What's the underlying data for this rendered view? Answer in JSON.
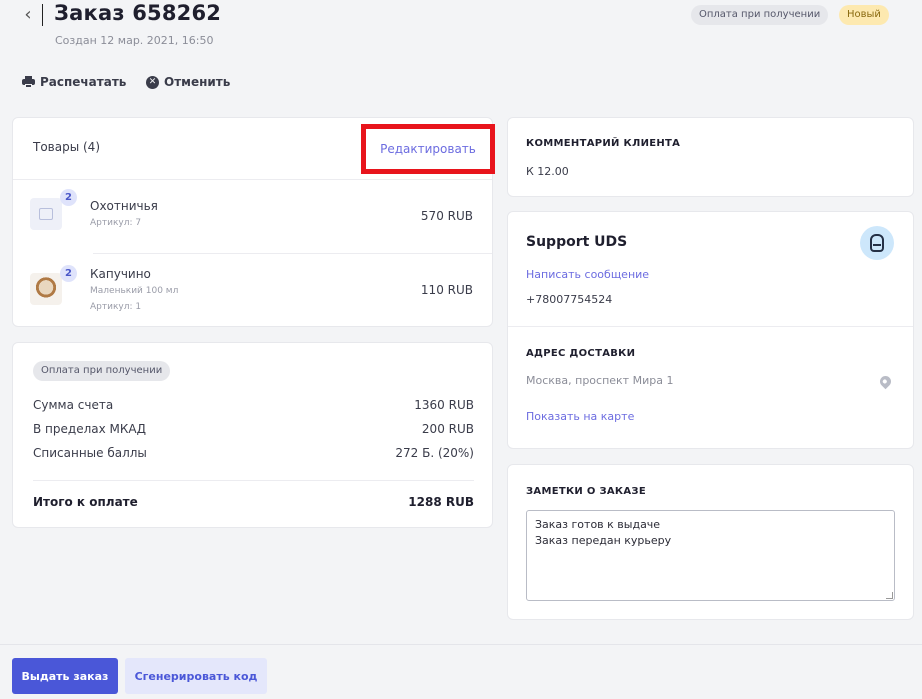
{
  "header": {
    "title": "Заказ 658262",
    "created": "Создан 12 мар. 2021, 16:50",
    "badge_payment": "Оплата при получении",
    "badge_status": "Новый",
    "back_icon": "chevron-left-icon"
  },
  "actions": {
    "print_label": "Распечатать",
    "cancel_label": "Отменить"
  },
  "goods": {
    "title": "Товары (4)",
    "edit_label": "Редактировать",
    "items": [
      {
        "name": "Охотничья",
        "sub1": "Артикул: 7",
        "sub2": "",
        "qty": "2",
        "price": "570 RUB"
      },
      {
        "name": "Капучино",
        "sub1": "Маленький 100 мл",
        "sub2": "Артикул: 1",
        "qty": "2",
        "price": "110 RUB"
      }
    ]
  },
  "payment": {
    "badge": "Оплата при получении",
    "rows": [
      {
        "label": "Сумма счета",
        "value": "1360 RUB"
      },
      {
        "label": "В пределах МКАД",
        "value": "200 RUB"
      },
      {
        "label": "Списанные баллы",
        "value": "272 Б. (20%)"
      }
    ],
    "total_label": "Итого к оплате",
    "total_value": "1288 RUB"
  },
  "comment": {
    "title": "КОММЕНТАРИЙ КЛИЕНТА",
    "text": "К 12.00"
  },
  "support": {
    "name": "Support UDS",
    "message_link": "Написать сообщение",
    "phone": "+78007754524",
    "address_title": "АДРЕС ДОСТАВКИ",
    "address": "Москва, проспект Мира 1",
    "map_link": "Показать на карте"
  },
  "notes": {
    "title": "ЗАМЕТКИ О ЗАКАЗЕ",
    "text": "Заказ готов к выдаче\nЗаказ передан курьеру"
  },
  "footer": {
    "issue_label": "Выдать заказ",
    "generate_label": "Сгенерировать код"
  },
  "colors": {
    "accent": "#4a57d8",
    "link": "#6c6ce0",
    "highlight": "#e8141c",
    "status_new_bg": "#fde9b0"
  }
}
